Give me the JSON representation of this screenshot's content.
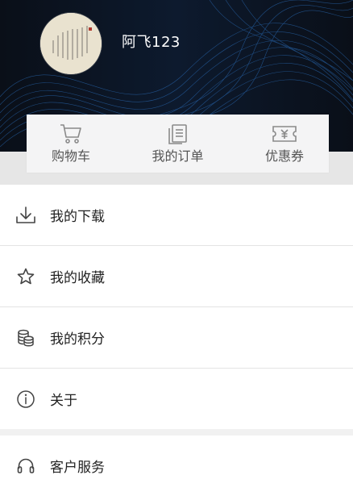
{
  "profile": {
    "username": "阿飞123",
    "avatar_icon": "calligraphy-avatar"
  },
  "quick_actions": [
    {
      "label": "购物车",
      "icon": "cart-icon"
    },
    {
      "label": "我的订单",
      "icon": "orders-icon"
    },
    {
      "label": "优惠券",
      "icon": "coupon-icon"
    }
  ],
  "menu": [
    {
      "label": "我的下载",
      "icon": "download-icon"
    },
    {
      "label": "我的收藏",
      "icon": "star-icon"
    },
    {
      "label": "我的积分",
      "icon": "points-icon"
    },
    {
      "label": "关于",
      "icon": "info-icon"
    },
    {
      "label": "客户服务",
      "icon": "headset-icon"
    }
  ],
  "colors": {
    "header_bg": "#0b1220",
    "wave": "#2f7bd1",
    "card_bg": "#f4f4f5",
    "text_primary": "#222222",
    "text_secondary": "#555555"
  }
}
